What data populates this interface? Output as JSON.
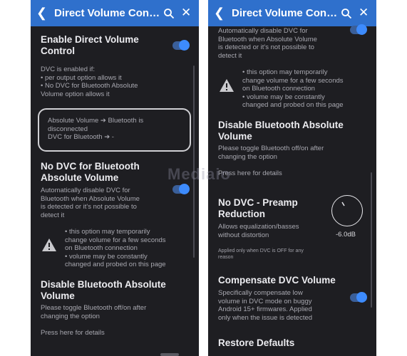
{
  "app": {
    "title": "Direct Volume Control"
  },
  "left": {
    "enable": {
      "title_l1": "Enable Direct Volume",
      "title_l2": "Control"
    },
    "conditions": {
      "l1": "DVC is enabled if:",
      "l2": "• per output option allows it",
      "l3": "• No DVC for Bluetooth Absolute",
      "l4": "Volume option allows it"
    },
    "info": {
      "l1": "Absolute Volume ➔ Bluetooth is",
      "l2": "disconnected",
      "l3": "DVC for Bluetooth ➔ -"
    },
    "nodvc_bt": {
      "title_l1": "No DVC for Bluetooth",
      "title_l2": "Absolute Volume",
      "d1": "Automatically disable DVC for",
      "d2": "Bluetooth when Absolute Volume",
      "d3": "is detected or it's not possible to",
      "d4": "detect it"
    },
    "warning": {
      "l1": "• this option may temporarily",
      "l2": "change volume for a few seconds",
      "l3": "on Bluetooth connection",
      "l4": "• volume may be constantly",
      "l5": "changed and probed on this page"
    },
    "disable_abs": {
      "title_l1": "Disable Bluetooth Absolute",
      "title_l2": "Volume",
      "d1": "Please toggle Bluetooth off/on after",
      "d2": "changing the option",
      "link": "Press here for details"
    }
  },
  "right": {
    "top_desc": {
      "d1": "Automatically disable DVC for",
      "d2": "Bluetooth when Absolute Volume",
      "d3": "is detected or it's not possible to",
      "d4": "detect it"
    },
    "warning": {
      "l1": "• this option may temporarily",
      "l2": "change volume for a few seconds",
      "l3": "on Bluetooth connection",
      "l4": "• volume may be constantly",
      "l5": "changed and probed on this page"
    },
    "disable_abs": {
      "title_l1": "Disable Bluetooth Absolute",
      "title_l2": "Volume",
      "d1": "Please toggle Bluetooth off/on after",
      "d2": "changing the option",
      "link": "Press here for details"
    },
    "preamp": {
      "title_l1": "No DVC - Preamp",
      "title_l2": "Reduction",
      "d1": "Allows equalization/basses",
      "d2": "without distortion",
      "value": "-6.0dB",
      "note1": "Applied only when DVC is OFF for any",
      "note2": "reason"
    },
    "compensate": {
      "title": "Compensate DVC Volume",
      "d1": "Specifically compensate low",
      "d2": "volume in DVC mode on buggy",
      "d3": "Android 15+ firmwares. Applied",
      "d4": "only when the issue is detected"
    },
    "restore": {
      "title": "Restore Defaults"
    }
  },
  "watermark": "Mediaio",
  "colors": {
    "header": "#2f70cc",
    "background": "#1e1e22",
    "toggle_on": "#3d8bfd"
  },
  "toggles": {
    "enable_dvc": true,
    "nodvc_bt": true,
    "compensate": true
  }
}
